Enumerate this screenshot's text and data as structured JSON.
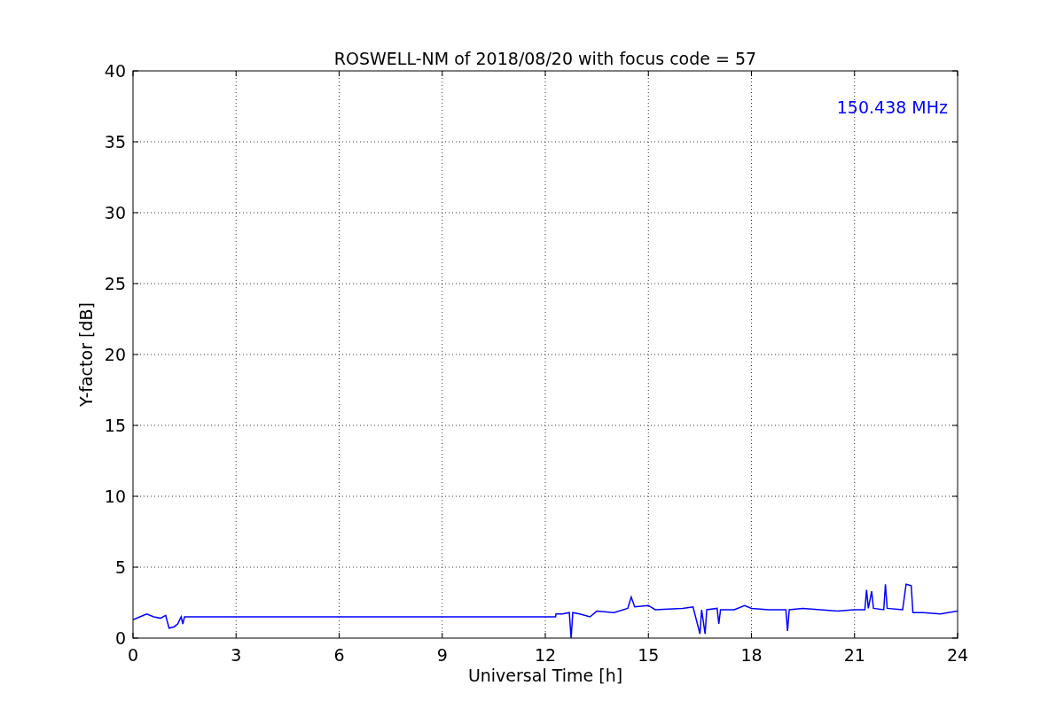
{
  "chart_data": {
    "type": "line",
    "title": "ROSWELL-NM of 2018/08/20 with focus code = 57",
    "xlabel": "Universal Time [h]",
    "ylabel": "Y-factor [dB]",
    "x": [
      0,
      0.2,
      0.4,
      0.6,
      0.8,
      0.95,
      1.05,
      1.2,
      1.3,
      1.4,
      1.45,
      1.5,
      12.3,
      12.31,
      12.5,
      12.7,
      12.75,
      12.8,
      13.0,
      13.3,
      13.5,
      14.0,
      14.4,
      14.5,
      14.6,
      15.0,
      15.2,
      16.0,
      16.3,
      16.5,
      16.55,
      16.65,
      16.7,
      17.0,
      17.05,
      17.1,
      17.5,
      17.8,
      18.0,
      18.5,
      19.0,
      19.05,
      19.1,
      19.5,
      20.0,
      20.5,
      21.0,
      21.3,
      21.35,
      21.4,
      21.5,
      21.55,
      21.85,
      21.9,
      21.95,
      22.4,
      22.5,
      22.65,
      22.7,
      23.0,
      23.5,
      24.0
    ],
    "series": [
      {
        "name": "150.438 MHz",
        "color": "#0000ff",
        "values": [
          1.3,
          1.5,
          1.7,
          1.5,
          1.4,
          1.6,
          0.7,
          0.8,
          1.0,
          1.5,
          1.0,
          1.5,
          1.5,
          1.7,
          1.7,
          1.8,
          0.0,
          1.8,
          1.7,
          1.5,
          1.9,
          1.8,
          2.1,
          2.9,
          2.2,
          2.3,
          2.0,
          2.1,
          2.2,
          0.3,
          2.0,
          0.3,
          2.0,
          2.1,
          1.0,
          2.0,
          2.0,
          2.3,
          2.1,
          2.0,
          2.0,
          0.5,
          2.0,
          2.1,
          2.0,
          1.9,
          2.0,
          2.0,
          3.4,
          2.1,
          3.3,
          2.1,
          2.0,
          3.8,
          2.1,
          2.0,
          3.8,
          3.7,
          1.8,
          1.8,
          1.7,
          1.9
        ]
      }
    ],
    "xlim": [
      0,
      24
    ],
    "ylim": [
      0,
      40
    ],
    "xticks": [
      0,
      3,
      6,
      9,
      12,
      15,
      18,
      21,
      24
    ],
    "yticks": [
      0,
      5,
      10,
      15,
      20,
      25,
      30,
      35,
      40
    ],
    "grid": true
  }
}
